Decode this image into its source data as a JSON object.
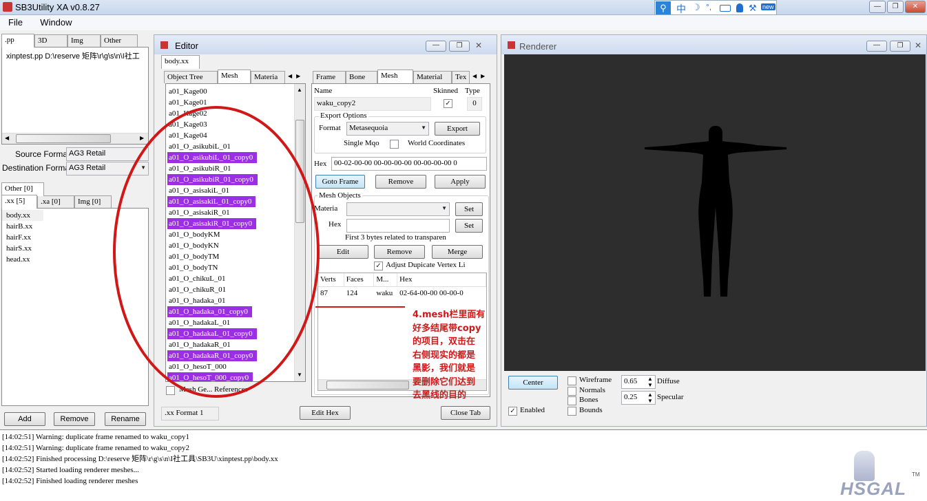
{
  "app": {
    "title": "SB3Utility XA v0.8.27"
  },
  "menu": {
    "file": "File",
    "window": "Window"
  },
  "ime": {
    "zh": "中",
    "moon": "☽",
    "deg": "°,",
    "new": "new"
  },
  "left": {
    "tabs": [
      ".pp",
      "3D",
      "Img",
      "Other"
    ],
    "pp_row": "xinptest.pp  D:\\reserve 矩阵\\r\\g\\s\\n\\I社工",
    "source_format_label": "Source Format",
    "source_format_value": "AG3 Retail",
    "dest_format_label": "Destination Format",
    "dest_format_value": "AG3 Retail",
    "other_tab": "Other [0]",
    "sub_tabs": [
      ".xx [5]",
      ".xa [0]",
      "Img [0]"
    ],
    "files": [
      "body.xx",
      "hairB.xx",
      "hairF.xx",
      "hairS.xx",
      "head.xx"
    ],
    "add": "Add",
    "remove": "Remove",
    "rename": "Rename"
  },
  "editor": {
    "title": "Editor",
    "doc_tab": "body.xx",
    "left_tabs": [
      "Object Tree",
      "Mesh",
      "Materia"
    ],
    "meshes": [
      {
        "name": "a01_Kage00",
        "copy": false
      },
      {
        "name": "a01_Kage01",
        "copy": false
      },
      {
        "name": "a01_Kage02",
        "copy": false
      },
      {
        "name": "a01_Kage03",
        "copy": false
      },
      {
        "name": "a01_Kage04",
        "copy": false
      },
      {
        "name": "a01_O_asikubiL_01",
        "copy": false
      },
      {
        "name": "a01_O_asikubiL_01_copy0",
        "copy": true
      },
      {
        "name": "a01_O_asikubiR_01",
        "copy": false
      },
      {
        "name": "a01_O_asikubiR_01_copy0",
        "copy": true
      },
      {
        "name": "a01_O_asisakiL_01",
        "copy": false
      },
      {
        "name": "a01_O_asisakiL_01_copy0",
        "copy": true
      },
      {
        "name": "a01_O_asisakiR_01",
        "copy": false
      },
      {
        "name": "a01_O_asisakiR_01_copy0",
        "copy": true
      },
      {
        "name": "a01_O_bodyKM",
        "copy": false
      },
      {
        "name": "a01_O_bodyKN",
        "copy": false
      },
      {
        "name": "a01_O_bodyTM",
        "copy": false
      },
      {
        "name": "a01_O_bodyTN",
        "copy": false
      },
      {
        "name": "a01_O_chikuL_01",
        "copy": false
      },
      {
        "name": "a01_O_chikuR_01",
        "copy": false
      },
      {
        "name": "a01_O_hadaka_01",
        "copy": false
      },
      {
        "name": "a01_O_hadaka_01_copy0",
        "copy": true
      },
      {
        "name": "a01_O_hadakaL_01",
        "copy": false
      },
      {
        "name": "a01_O_hadakaL_01_copy0",
        "copy": true
      },
      {
        "name": "a01_O_hadakaR_01",
        "copy": false
      },
      {
        "name": "a01_O_hadakaR_01_copy0",
        "copy": true
      },
      {
        "name": "a01_O_hesoT_000",
        "copy": false
      },
      {
        "name": "a01_O_hesoT_000_copy0",
        "copy": true
      }
    ],
    "mesh_refs_label": "Mesh Ge... References",
    "right_tabs": [
      "Frame",
      "Bone",
      "Mesh",
      "Material",
      "Tex"
    ],
    "name_label": "Name",
    "name_value": "waku_copy2",
    "skinned_label": "Skinned",
    "skinned_checked": "✓",
    "type_label": "Type",
    "type_value": "0",
    "export_options_label": "Export Options",
    "format_label": "Format",
    "format_value": "Metasequoia",
    "export_btn": "Export",
    "single_mqo": "Single Mqo",
    "world_coords": "World Coordinates",
    "hex_label": "Hex",
    "hex_value": "00-02-00-00 00-00-00-00 00-00-00-00 0",
    "goto_frame": "Goto Frame",
    "remove_btn": "Remove",
    "apply_btn": "Apply",
    "mesh_objects_label": "Mesh Objects",
    "material_label": "Materia",
    "set_btn": "Set",
    "hex2_label": "Hex",
    "first3_note": "First 3 bytes related to transparen",
    "edit_btn": "Edit",
    "remove2_btn": "Remove",
    "merge_btn": "Merge",
    "adjust_label": "Adjust Dupicate Vertex Li",
    "adjust_checked": "✓",
    "table_headers": [
      "Verts",
      "Faces",
      "M...",
      "Hex"
    ],
    "table_rows": [
      [
        "87",
        "124",
        "waku",
        "02-64-00-00 00-00-0"
      ]
    ],
    "status_format": ".xx Format 1",
    "edit_hex": "Edit Hex",
    "close_tab": "Close Tab"
  },
  "annotation": {
    "text": "4.mesh栏里面有好多结尾带copy的项目，双击在右侧现实的都是黑影，我们就是要删除它们达到去黑线的目的",
    "lines": [
      "4.mesh栏里面有",
      "好多结尾带copy",
      "的项目，双击在",
      "右侧现实的都是",
      "黑影，我们就是",
      "要删除它们达到",
      "去黑线的目的"
    ],
    "color": "#d01818"
  },
  "renderer": {
    "title": "Renderer",
    "center_btn": "Center",
    "enabled_label": "Enabled",
    "enabled_checked": "✓",
    "wireframe": "Wireframe",
    "normals": "Normals",
    "bones": "Bones",
    "bounds": "Bounds",
    "diffuse_value": "0.65",
    "diffuse_label": "Diffuse",
    "specular_value": "0.25",
    "specular_label": "Specular"
  },
  "log": [
    "[14:02:51] Warning: duplicate frame renamed to waku_copy1",
    "[14:02:51] Warning: duplicate frame renamed to waku_copy2",
    "[14:02:52] Finished processing D:\\reserve 矩阵\\r\\g\\s\\n\\I社工具\\SB3U\\xinptest.pp\\body.xx",
    "[14:02:52] Started loading renderer meshes...",
    "[14:02:52] Finished loading renderer meshes"
  ],
  "watermark": {
    "text": "HSGAL",
    "tm": "TM"
  }
}
